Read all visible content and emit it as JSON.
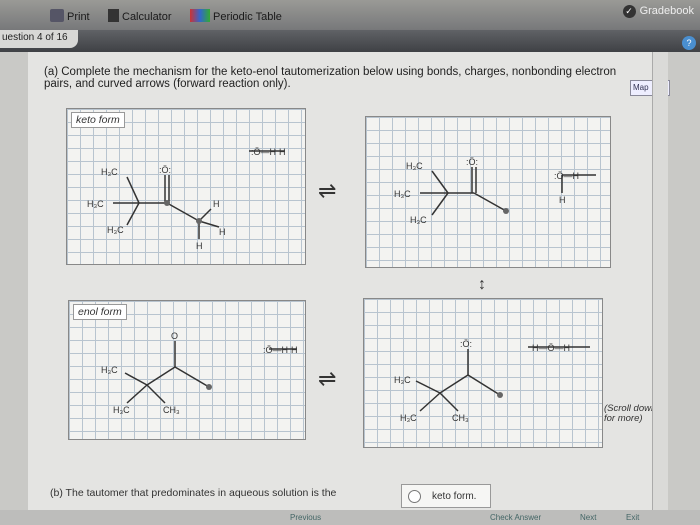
{
  "toolbar": {
    "print": "Print",
    "calculator": "Calculator",
    "periodic_table": "Periodic Table",
    "gradebook": "Gradebook"
  },
  "question": {
    "counter": "uestion 4 of 16",
    "part_a": "(a) Complete the mechanism for the keto-enol tautomerization below using bonds, charges, nonbonding electron pairs, and curved arrows (forward reaction only).",
    "map_label": "Map",
    "keto_label": "keto form",
    "enol_label": "enol form",
    "scroll_note": "(Scroll down for more)",
    "part_b": "(b) The tautomer that predominates in aqueous solution is the",
    "answer_value": "keto form."
  },
  "chem": {
    "h3c": "H₃C",
    "ch3": "CH₃",
    "h": "H",
    "o_lone": ":Ö:",
    "o": "O",
    "ho_h": ":Ö—H",
    "h_o_h": "H—Ö—H",
    "o_plain": ":Ö—H"
  },
  "bottom": {
    "previous": "Previous",
    "check": "Check Answer",
    "next": "Next",
    "exit": "Exit"
  }
}
